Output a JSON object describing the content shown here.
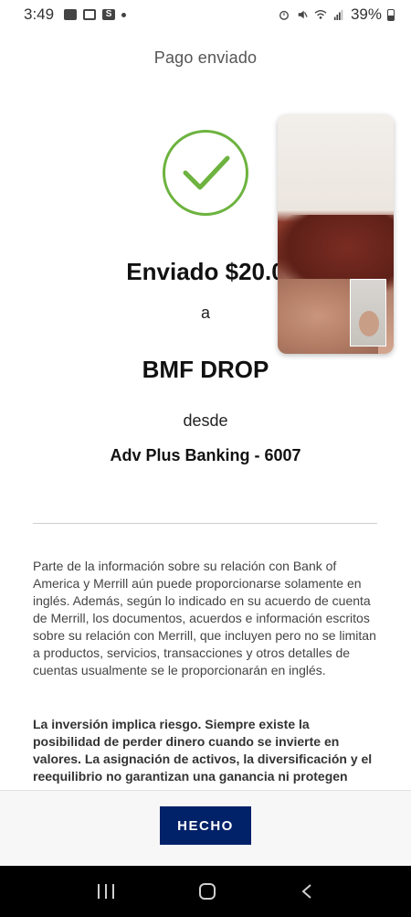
{
  "status_bar": {
    "time": "3:49",
    "battery": "39%",
    "left_icons": [
      "image-icon",
      "gmail-icon",
      "s-app-icon",
      "dot-icon"
    ],
    "right_icons": [
      "alarm-icon",
      "mute-icon",
      "wifi-icon",
      "signal-icon",
      "battery-icon"
    ]
  },
  "header": {
    "title": "Pago enviado"
  },
  "confirmation": {
    "sent_amount": "Enviado $20.0",
    "to_label": "a",
    "recipient": "BMF DROP",
    "from_label": "desde",
    "account": "Adv Plus Banking - 6007",
    "accent_color": "#6db33f"
  },
  "disclaimer": "Parte de la información sobre su relación con Bank of America y Merrill aún puede proporcionarse solamente en inglés. Además, según lo indicado en su acuerdo de cuenta de Merrill, los documentos, acuerdos e información escritos sobre su relación con Merrill, que incluyen pero no se limitan a productos, servicios, transacciones y otros detalles de cuentas usualmente se le proporcionarán en inglés.",
  "risk_notice": "La inversión implica riesgo. Siempre existe la posibilidad de perder dinero cuando se invierte en valores. La asignación de activos, la diversificación y el reequilibrio no garantizan una ganancia ni protegen",
  "footer": {
    "done_label": "HECHO",
    "button_color": "#012169"
  },
  "navbar": {
    "icons": [
      "recents-icon",
      "home-icon",
      "back-icon"
    ]
  }
}
